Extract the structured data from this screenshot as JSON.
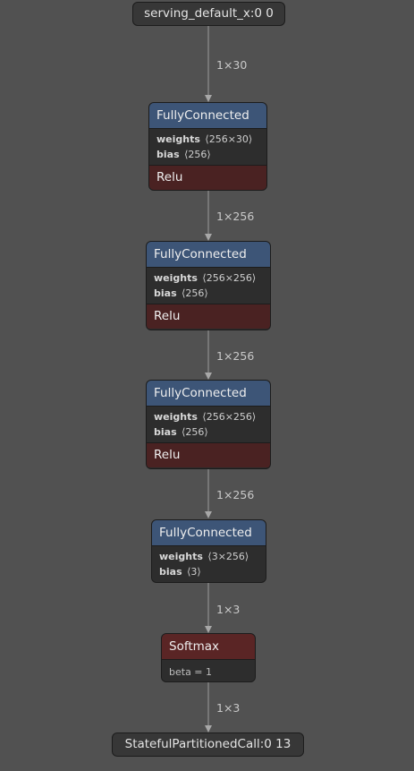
{
  "graph": {
    "input": {
      "label": "serving_default_x:0 0"
    },
    "output": {
      "label": "StatefulPartitionedCall:0 13"
    },
    "fc1": {
      "title": "FullyConnected",
      "weights_name": "weights",
      "weights_shape": "⟨256×30⟩",
      "bias_name": "bias",
      "bias_shape": "⟨256⟩",
      "activation": "Relu"
    },
    "fc2": {
      "title": "FullyConnected",
      "weights_name": "weights",
      "weights_shape": "⟨256×256⟩",
      "bias_name": "bias",
      "bias_shape": "⟨256⟩",
      "activation": "Relu"
    },
    "fc3": {
      "title": "FullyConnected",
      "weights_name": "weights",
      "weights_shape": "⟨256×256⟩",
      "bias_name": "bias",
      "bias_shape": "⟨256⟩",
      "activation": "Relu"
    },
    "fc4": {
      "title": "FullyConnected",
      "weights_name": "weights",
      "weights_shape": "⟨3×256⟩",
      "bias_name": "bias",
      "bias_shape": "⟨3⟩"
    },
    "softmax": {
      "title": "Softmax",
      "attr": "beta = 1"
    },
    "edges": [
      "1×30",
      "1×256",
      "1×256",
      "1×256",
      "1×3",
      "1×3"
    ]
  },
  "colors": {
    "background": "#515151",
    "layer_header": "#3d5577",
    "activation": "#5a2525",
    "node_body": "#2d2d2d",
    "edge": "#9a9a9a"
  }
}
